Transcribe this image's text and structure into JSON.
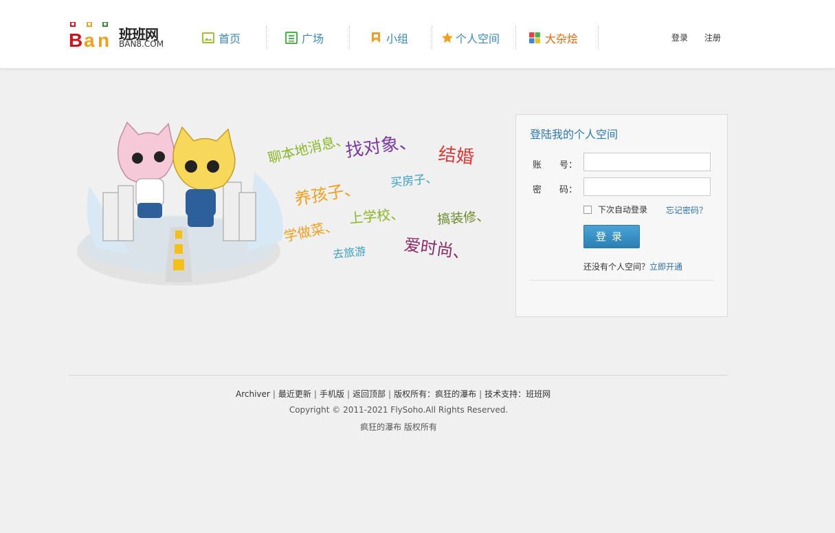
{
  "header": {
    "logo": {
      "mark": "BaN",
      "cn": "班班网",
      "en": "BAN8.COM"
    },
    "nav": [
      {
        "label": "首页",
        "icon": "image-icon",
        "color": "#9ac52e"
      },
      {
        "label": "广场",
        "icon": "list-icon",
        "color": "#4ab34a"
      },
      {
        "label": "小组",
        "icon": "bookmark-icon",
        "color": "#f0a020"
      },
      {
        "label": "个人空间",
        "icon": "star-icon",
        "color": "#f0a020"
      },
      {
        "label": "大杂烩",
        "icon": "puzzle-icon",
        "color": "#e86a10"
      }
    ],
    "login_link": "登录",
    "register_link": "注册"
  },
  "illustration": {
    "phrases": [
      "聊本地消息、",
      "找对象、",
      "结婚",
      "养孩子、",
      "买房子、",
      "上学校、",
      "搞装修、",
      "学做菜、",
      "去旅游",
      "爱时尚、"
    ]
  },
  "login": {
    "title": "登陆我的个人空间",
    "account_label": "账　　号：",
    "account_value": "",
    "password_label": "密　　码：",
    "password_value": "",
    "remember_label": "下次自动登录",
    "forgot_link": "忘记密码？",
    "submit_label": "登录",
    "no_account_text": "还没有个人空间？",
    "signup_link": "立即开通"
  },
  "footer": {
    "links": [
      "Archiver",
      "最近更新",
      "手机版",
      "返回顶部",
      "版权所有：疯狂的瀑布",
      "技术支持：班班网"
    ],
    "copyright": "Copyright © 2011-2021 FlySoho.All Rights Reserved.",
    "owner": "疯狂的瀑布 版权所有"
  },
  "colors": {
    "accent": "#2c78a8",
    "link": "#2c6eb0",
    "nav": "#3a8ab8"
  }
}
